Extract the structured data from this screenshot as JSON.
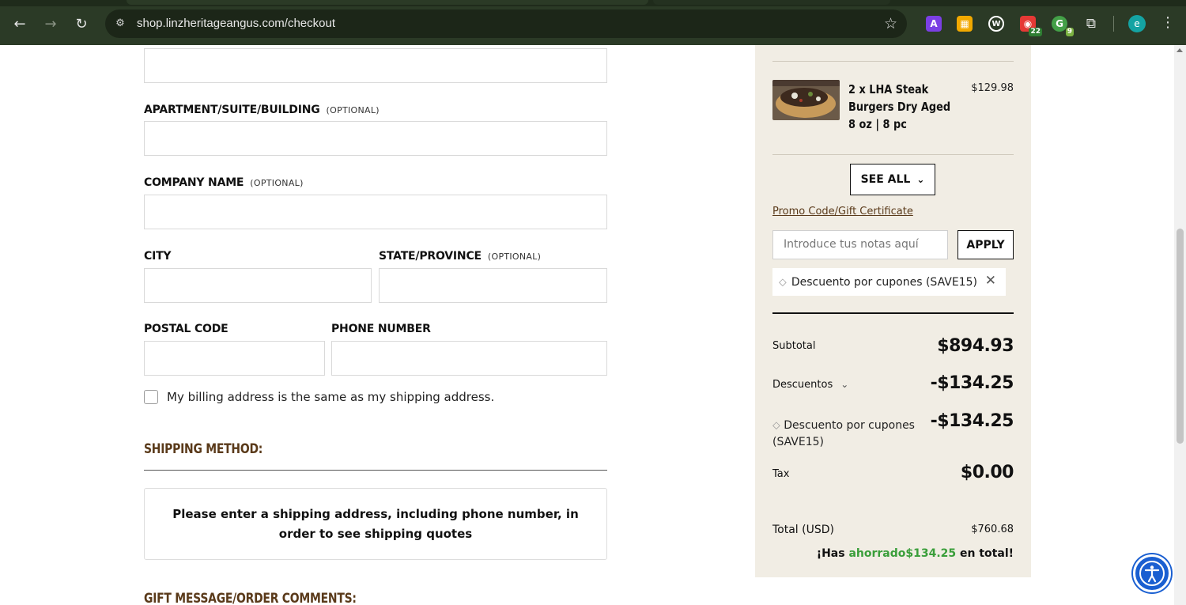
{
  "browser": {
    "url": "shop.linzheritageangus.com/checkout",
    "extensions": [
      {
        "name": "a-icon",
        "letter": "A",
        "color": "#7b3fe4"
      },
      {
        "name": "grid-icon",
        "letter": "▦",
        "color": "#f2a900"
      },
      {
        "name": "w-icon",
        "letter": "W",
        "color": "#222222"
      },
      {
        "name": "calendar-icon",
        "letter": "◉",
        "color": "#e53935",
        "badge": "22"
      },
      {
        "name": "g-icon",
        "letter": "G",
        "color": "#43a047",
        "badge": "9"
      }
    ],
    "profile_initial": "e"
  },
  "form": {
    "apartment_label": "APARTMENT/SUITE/BUILDING",
    "apartment_optional": "(OPTIONAL)",
    "company_label": "COMPANY NAME",
    "company_optional": "(OPTIONAL)",
    "city_label": "CITY",
    "state_label": "STATE/PROVINCE",
    "state_optional": "(OPTIONAL)",
    "postal_label": "POSTAL CODE",
    "phone_label": "PHONE NUMBER",
    "billing_same_label": "My billing address is the same as my shipping address.",
    "shipping_method_title": "SHIPPING METHOD:",
    "shipping_message": "Please enter a shipping address, including phone number, in order to see shipping quotes",
    "gift_message_title": "GIFT MESSAGE/ORDER COMMENTS:"
  },
  "summary": {
    "product": {
      "name_line1": "2 x LHA Steak",
      "name_line2": "Burgers Dry Aged",
      "name_line3": "8 oz | 8 pc",
      "price": "$129.98"
    },
    "see_all": "SEE ALL",
    "promo_link": "Promo Code/Gift Certificate",
    "promo_placeholder": "Introduce tus notas aquí",
    "apply": "APPLY",
    "coupon_chip": "Descuento por cupones (SAVE15)",
    "subtotal_label": "Subtotal",
    "subtotal_value": "$894.93",
    "discounts_label": "Descuentos",
    "discounts_value": "-$134.25",
    "coupon_line": "Descuento por cupones (SAVE15)",
    "coupon_value": "-$134.25",
    "tax_label": "Tax",
    "tax_value": "$0.00",
    "total_label": "Total (USD)",
    "total_value": "$760.68",
    "saved_prefix": "¡Has ",
    "saved_green": "ahorrado$134.25",
    "saved_suffix": " en total!"
  },
  "colors": {
    "chrome": "#2b3a26",
    "summary_bg": "#f1ede4",
    "section_title": "#5a3a1a",
    "saved_green": "#3a9e3a",
    "a11y_blue": "#1a5fd1"
  }
}
